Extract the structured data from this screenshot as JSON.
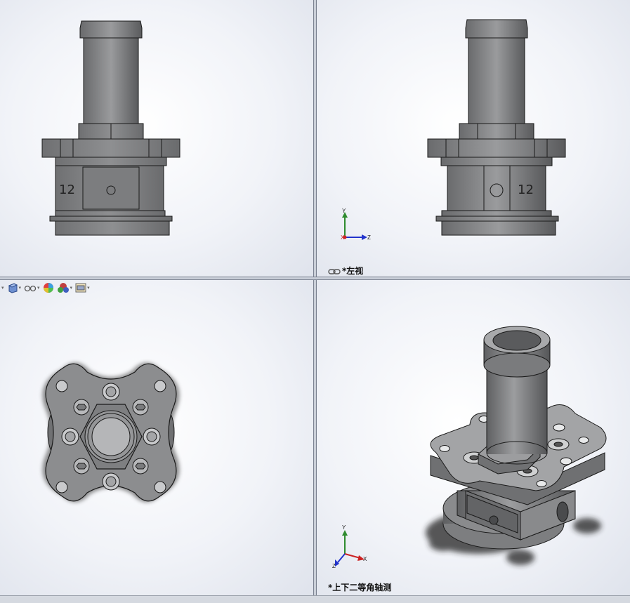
{
  "viewports": {
    "top_left": {
      "part_label": "12"
    },
    "top_right": {
      "label": "*左视",
      "part_label": "12",
      "triad": {
        "y": "Y",
        "z": "Z",
        "x": "X"
      }
    },
    "bottom_left": {
      "toolbar_icons": [
        "view-orientation-icon",
        "display-style-icon",
        "hide-show-icon",
        "appearance-icon",
        "scene-icon",
        "view-settings-icon"
      ]
    },
    "bottom_right": {
      "label": "*上下二等角轴测",
      "triad": {
        "y": "Y",
        "z": "Z",
        "x": "X"
      }
    }
  },
  "colors": {
    "part": "#8a8b8d",
    "part_dark": "#5f6062",
    "edge": "#1a1a1a",
    "triad_y": "#2e8b2e",
    "triad_z": "#2233cc",
    "triad_x": "#cc2222"
  }
}
